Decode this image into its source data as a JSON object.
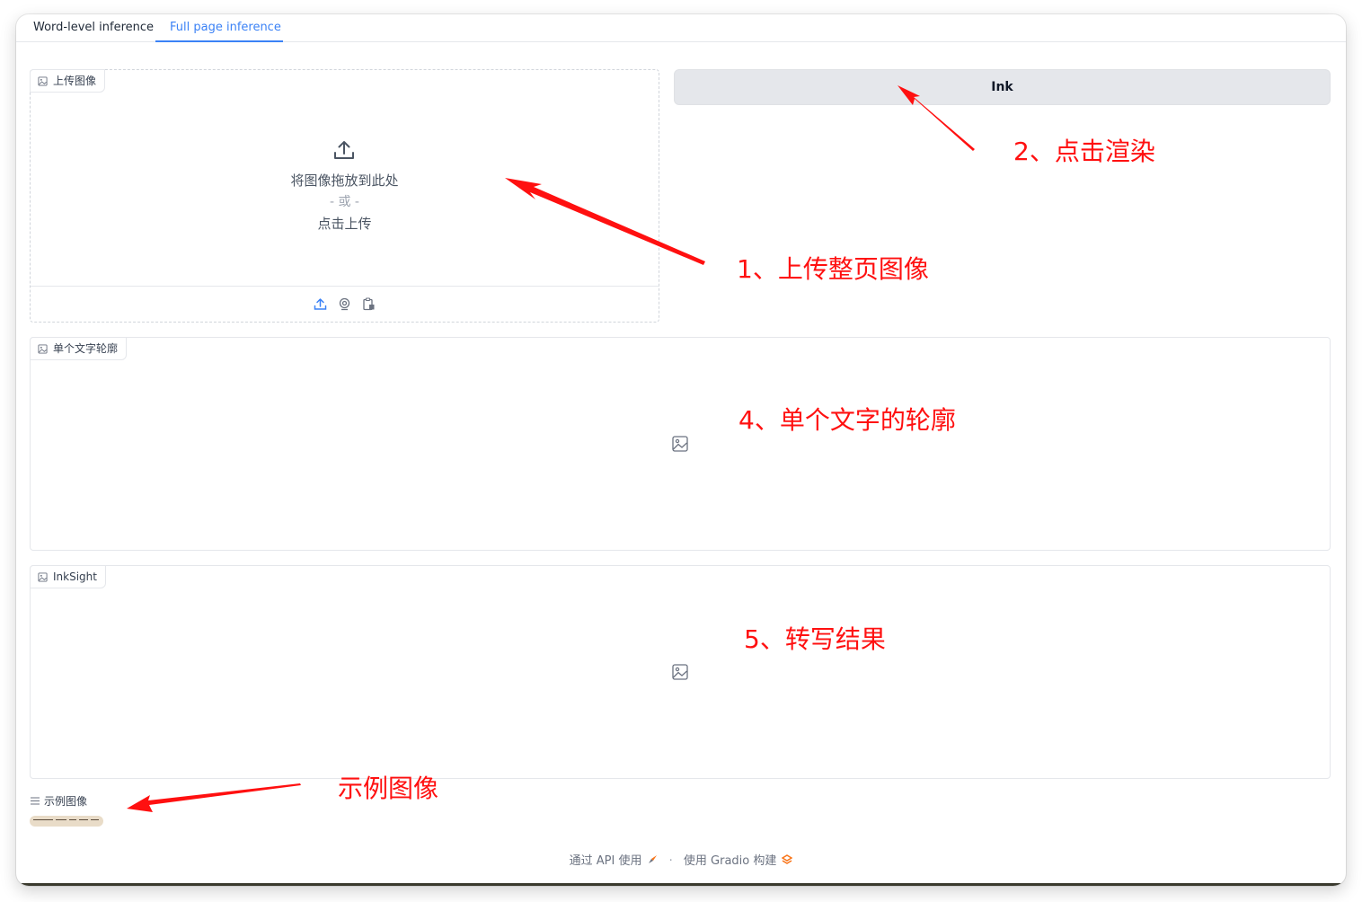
{
  "tabs": [
    {
      "label": "Word-level inference",
      "active": false
    },
    {
      "label": "Full page inference",
      "active": true
    }
  ],
  "upload": {
    "label": "上传图像",
    "drop_text": "将图像拖放到此处",
    "or_text": "- 或 -",
    "click_text": "点击上传",
    "tools": [
      "upload-icon",
      "webcam-icon",
      "clipboard-icon"
    ]
  },
  "ink_button": {
    "label": "Ink"
  },
  "outline_output": {
    "label": "单个文字轮廓"
  },
  "result_output": {
    "label": "InkSight"
  },
  "examples": {
    "label": "示例图像"
  },
  "footer": {
    "api_text": "通过 API 使用",
    "separator": "·",
    "built_text": "使用 Gradio 构建"
  },
  "annotations": {
    "step1": "1、上传整页图像",
    "step2": "2、点击渲染",
    "step4": "4、单个文字的轮廓",
    "step5": "5、转写结果",
    "examples_note": "示例图像"
  },
  "colors": {
    "accent": "#3b82f6",
    "annotation": "#ff1010",
    "button_bg": "#e5e7eb"
  }
}
